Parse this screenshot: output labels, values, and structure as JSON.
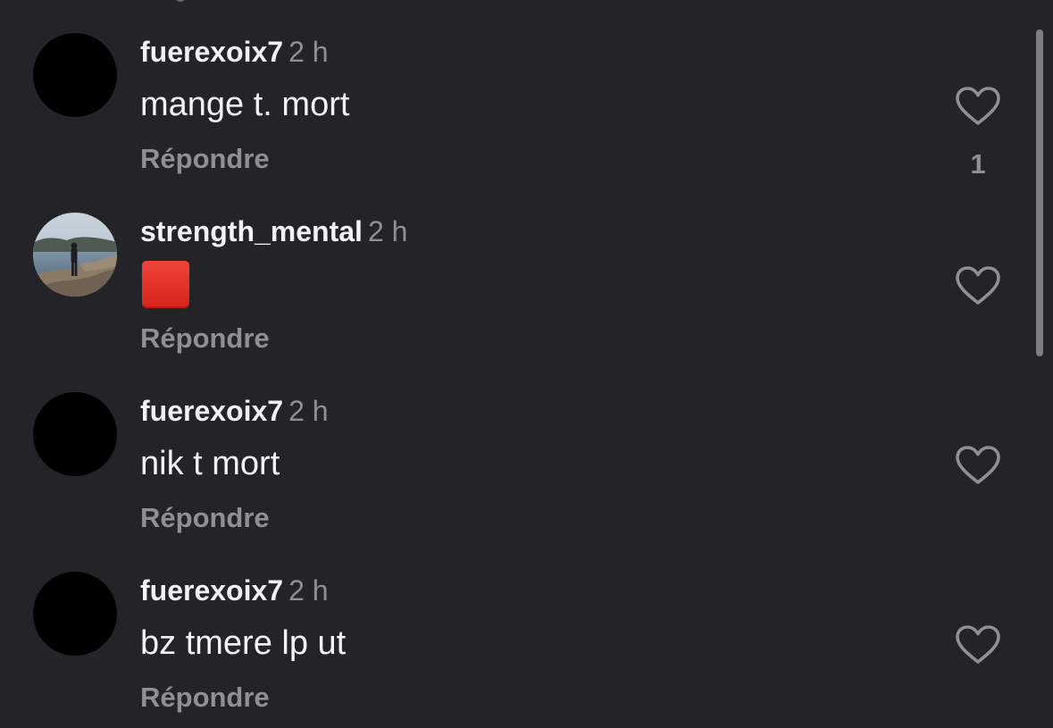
{
  "colors": {
    "background": "#232328",
    "primary_text": "#f3f3f5",
    "secondary_text": "#8e9096",
    "avatar_default": "#000000",
    "reaction_red": "#e0312a"
  },
  "comments": [
    {
      "username": "fuerexoix7",
      "time": "2 h",
      "text": "mange t. mort",
      "reply_label": "Répondre",
      "avatar": "black-circle",
      "like_icon": "heart-outline-icon",
      "like_count": "1"
    },
    {
      "username": "strength_mental",
      "time": "2 h",
      "text": "",
      "emoji": "red-square-emoji",
      "reply_label": "Répondre",
      "avatar": "photo-person-at-lake",
      "like_icon": "heart-outline-icon"
    },
    {
      "username": "fuerexoix7",
      "time": "2 h",
      "text": "nik t mort",
      "reply_label": "Répondre",
      "avatar": "black-circle",
      "like_icon": "heart-outline-icon"
    },
    {
      "username": "fuerexoix7",
      "time": "2 h",
      "text": "bz tmere lp ut",
      "reply_label": "Répondre",
      "avatar": "black-circle",
      "like_icon": "heart-outline-icon"
    }
  ]
}
